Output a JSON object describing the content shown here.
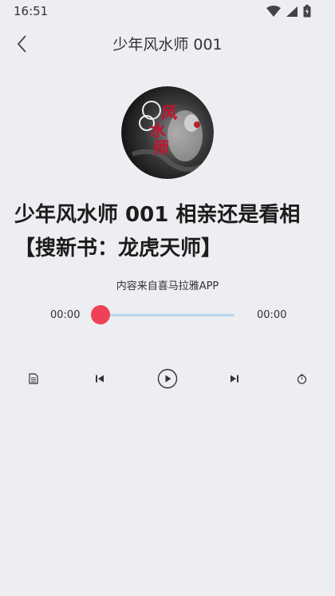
{
  "status_bar": {
    "time": "16:51"
  },
  "header": {
    "title": "少年风水师 001"
  },
  "cover": {
    "lettering": "风水师"
  },
  "track": {
    "title": "少年风水师 001 相亲还是看相【搜新书：龙虎天师】"
  },
  "source_note": "内容来自喜马拉雅APP",
  "player": {
    "current_time": "00:00",
    "total_time": "00:00",
    "progress": 0
  },
  "controls": {
    "icons": [
      "playlist-icon",
      "previous-icon",
      "play-icon",
      "next-icon",
      "timer-icon"
    ]
  },
  "colors": {
    "background": "#eceef1",
    "accent": "#ef4056",
    "track": "#b9d4ee"
  }
}
